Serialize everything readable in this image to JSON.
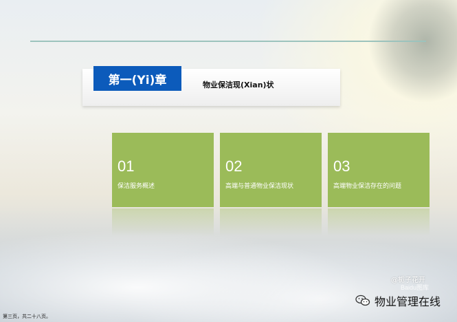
{
  "header": {
    "chapter_label": "第一(Yi)章",
    "chapter_title": "物业保洁现(Xian)状"
  },
  "cards": [
    {
      "number": "01",
      "label": "保洁服务概述"
    },
    {
      "number": "02",
      "label": "高端与普通物业保洁现状"
    },
    {
      "number": "03",
      "label": "高端物业保洁存在的问题"
    }
  ],
  "footer": {
    "page_info": "第三页，共二十八页。"
  },
  "watermark": {
    "author": "@栀子花开",
    "site": "Baidu图库",
    "brand": "物业管理在线",
    "brand_icon": "wechat-icon"
  },
  "colors": {
    "accent_blue": "#0c5bbb",
    "card_green": "#9bbb59",
    "line": "#9cc3bd"
  }
}
